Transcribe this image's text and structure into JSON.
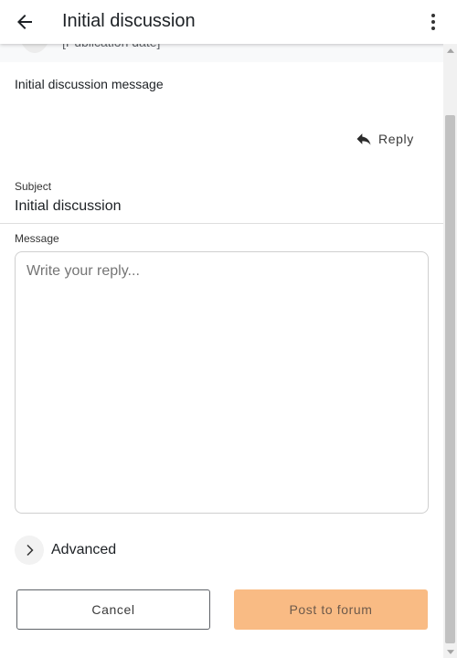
{
  "header": {
    "title": "Initial discussion",
    "back_icon": "arrow-left-icon",
    "more_icon": "more-vertical-icon"
  },
  "post": {
    "publication_date": "[Publication date]",
    "message": "Initial discussion message",
    "reply_label": "Reply",
    "reply_icon": "reply-icon"
  },
  "form": {
    "subject_label": "Subject",
    "subject_value": "Initial discussion",
    "message_label": "Message",
    "message_placeholder": "Write your reply...",
    "advanced_label": "Advanced",
    "cancel_label": "Cancel",
    "post_label": "Post to forum"
  },
  "colors": {
    "accent": "#f9bb84",
    "text": "#1d2125",
    "muted": "#757575"
  }
}
